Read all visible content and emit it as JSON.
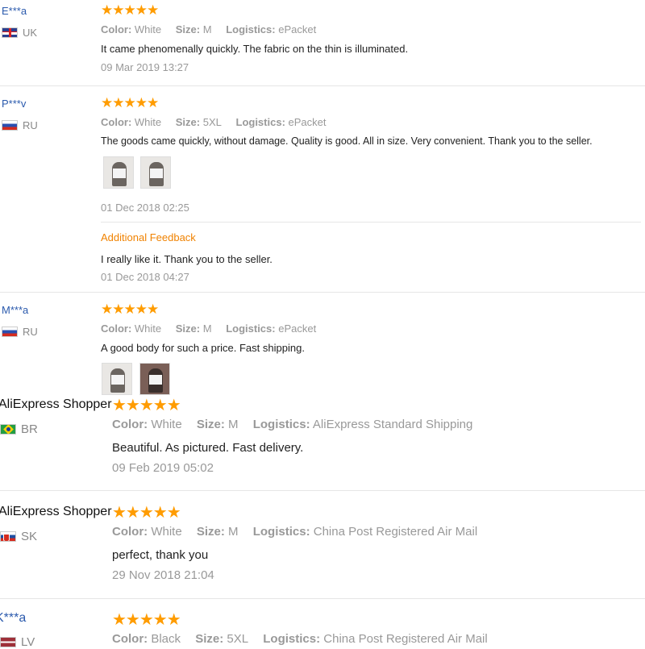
{
  "colors": {
    "username": "#2b5aad",
    "star": "#ff9c00",
    "additional_feedback": "#f08200",
    "meta": "#999999"
  },
  "star_icon": "star-icon",
  "labels": {
    "color": "Color:",
    "size": "Size:",
    "logistics": "Logistics:"
  },
  "reviews": [
    {
      "user": "E***a",
      "country": "UK",
      "flag": "uk-flag-icon",
      "rating": 5,
      "stars": "★★★★★",
      "color": "White",
      "size": "M",
      "logistics": "ePacket",
      "text": "It came phenomenally quickly. The fabric on the thin is illuminated.",
      "date": "09 Mar 2019 13:27"
    },
    {
      "user": "P***v",
      "country": "RU",
      "flag": "russia-flag-icon",
      "rating": 5,
      "stars": "★★★★★",
      "color": "White",
      "size": "5XL",
      "logistics": "ePacket",
      "text": "The goods came quickly, without damage. Quality is good. All in size. Very convenient. Thank you to the seller.",
      "date": "01 Dec 2018 02:25",
      "additional": {
        "heading": "Additional Feedback",
        "text": "I really like it. Thank you to the seller.",
        "date": "01 Dec 2018 04:27"
      }
    },
    {
      "user": "M***a",
      "country": "RU",
      "flag": "russia-flag-icon",
      "rating": 5,
      "stars": "★★★★★",
      "color": "White",
      "size": "M",
      "logistics": "ePacket",
      "text": "A good body for such a price. Fast shipping."
    },
    {
      "user": "AliExpress Shopper",
      "country": "BR",
      "flag": "brazil-flag-icon",
      "rating": 5,
      "stars": "★★★★★",
      "color": "White",
      "size": "M",
      "logistics": "AliExpress Standard Shipping",
      "text": "Beautiful. As pictured. Fast delivery.",
      "date": "09 Feb 2019 05:02"
    },
    {
      "user": "AliExpress Shopper",
      "country": "SK",
      "flag": "slovakia-flag-icon",
      "rating": 5,
      "stars": "★★★★★",
      "color": "White",
      "size": "M",
      "logistics": "China Post Registered Air Mail",
      "text": "perfect, thank you",
      "date": "29 Nov 2018 21:04"
    },
    {
      "user": "K***a",
      "country": "LV",
      "flag": "latvia-flag-icon",
      "rating": 5,
      "stars": "★★★★★",
      "color": "Black",
      "size": "5XL",
      "logistics": "China Post Registered Air Mail"
    }
  ]
}
